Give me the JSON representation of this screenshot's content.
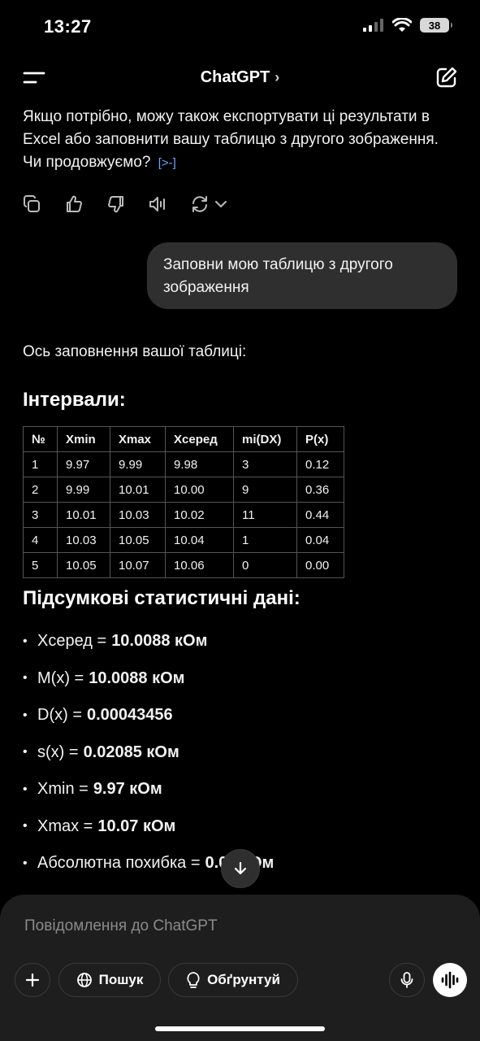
{
  "status_bar": {
    "time": "13:27",
    "battery": "38"
  },
  "header": {
    "title": "ChatGPT",
    "chevron": "›"
  },
  "assistant_prev_message": {
    "text": "Якщо потрібно, можу також експортувати ці результати в Excel або заповнити вашу таблицю з другого зображення. Чи продовжуємо?",
    "source_badge": "[>-]"
  },
  "message_actions": [
    "copy-icon",
    "thumbs-up-icon",
    "thumbs-down-icon",
    "speaker-icon",
    "regenerate-icon"
  ],
  "user_message": {
    "text": "Заповни мою таблицю з другого зображення"
  },
  "assistant_message": {
    "intro": "Ось заповнення вашої таблиці:",
    "intervals_heading": "Інтервали:",
    "table": {
      "headers": [
        "№",
        "Xmin",
        "Xmax",
        "Xсеред",
        "mi(DX)",
        "P(x)"
      ],
      "rows": [
        [
          "1",
          "9.97",
          "9.99",
          "9.98",
          "3",
          "0.12"
        ],
        [
          "2",
          "9.99",
          "10.01",
          "10.00",
          "9",
          "0.36"
        ],
        [
          "3",
          "10.01",
          "10.03",
          "10.02",
          "11",
          "0.44"
        ],
        [
          "4",
          "10.03",
          "10.05",
          "10.04",
          "1",
          "0.04"
        ],
        [
          "5",
          "10.05",
          "10.07",
          "10.06",
          "0",
          "0.00"
        ]
      ]
    },
    "summary_heading": "Підсумкові статистичні дані:",
    "stats": [
      {
        "label": "Xсеред =",
        "value": "10.0088 кОм"
      },
      {
        "label": "M(x) =",
        "value": "10.0088 кОм"
      },
      {
        "label": "D(x) =",
        "value": "0.00043456"
      },
      {
        "label": "s(x) =",
        "value": "0.02085 кОм"
      },
      {
        "label": "Xmin =",
        "value": "9.97 кОм"
      },
      {
        "label": "Xmax =",
        "value": "10.07 кОм"
      },
      {
        "label": "Абсолютна похибка =",
        "value": "0.05 кОм"
      }
    ]
  },
  "scroll_button": {
    "icon": "arrow-down-icon"
  },
  "composer": {
    "placeholder": "Повідомлення до ChatGPT",
    "search_label": "Пошук",
    "reason_label": "Обґрунтуй"
  },
  "colors": {
    "background": "#000000",
    "bubble": "#2f2f2f",
    "composer": "#1e1e1e",
    "accent_link": "#6ea4ff"
  }
}
